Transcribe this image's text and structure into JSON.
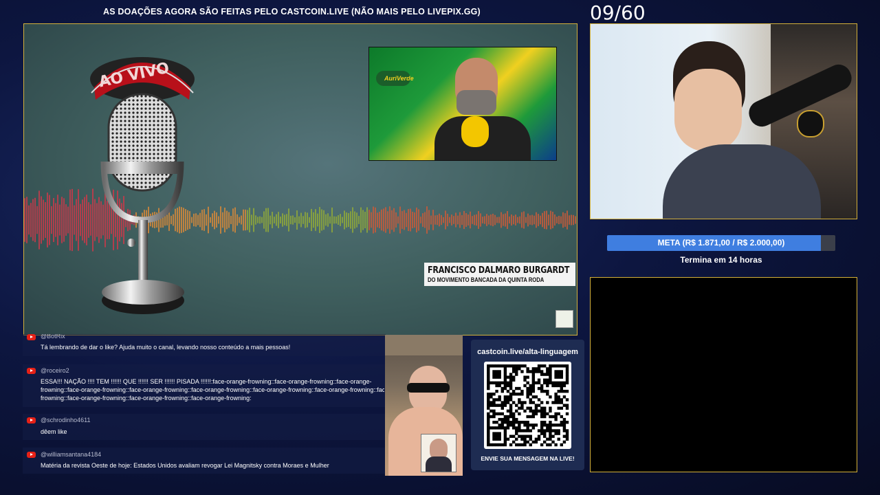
{
  "banner": "AS DOAÇÕES AGORA SÃO FEITAS PELO CASTCOIN.LIVE (NÃO MAIS PELO LIVEPIX.GG)",
  "counter": "09/60",
  "video": {
    "mic_sign": "AO VIVO",
    "lower_third_name": "FRANCISCO DALMARO BURGARDT",
    "lower_third_sub": "DO MOVIMENTO BANCADA DA QUINTA RODA",
    "inset_logo": "AuriVerde"
  },
  "goal": {
    "label": "META (R$ 1.871,00 / R$ 2.000,00)",
    "progress": 0.9355,
    "ends": "Termina em 14 horas",
    "fill_color": "#3f7ee0"
  },
  "chat": {
    "messages": [
      {
        "author": "@BotRix",
        "text": "Tá lembrando de dar o like? Ajuda muito o canal, levando nosso conteúdo a mais pessoas!"
      },
      {
        "author": "@roceiro2",
        "text_lines": [
          "ESSA!!! NAÇÃO !!!! TEM !!!!!! QUE !!!!!! SER !!!!!! PISADA !!!!!!:face-orange-frowning::face-orange-frowning::face-orange-",
          "frowning::face-orange-frowning::face-orange-frowning::face-orange-frowning::face-orange-frowning::face-orange-frowning::face-orange-",
          "frowning::face-orange-frowning::face-orange-frowning::face-orange-frowning:"
        ]
      },
      {
        "author": "@schrodinho4611",
        "text": "dêem like"
      },
      {
        "author": "@williamsantana4184",
        "text": "Matéria da revista Oeste de hoje: Estados Unidos avaliam revogar Lei Magnitsky contra Moraes e Mulher"
      }
    ]
  },
  "qr": {
    "title": "castcoin.live/alta-linguagem",
    "footer": "ENVIE SUA MENSAGEM NA LIVE!"
  },
  "icons": [
    "youtube-icon",
    "qr-code-icon",
    "microphone-icon"
  ]
}
